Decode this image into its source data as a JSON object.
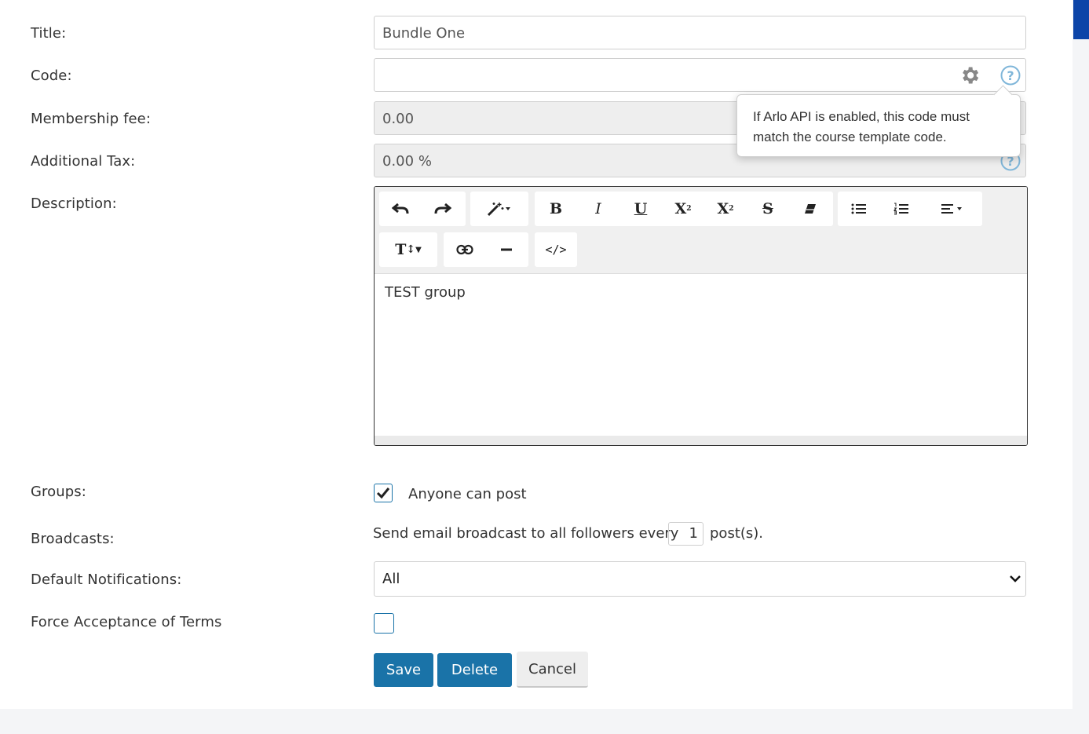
{
  "form": {
    "title": {
      "label": "Title:",
      "value": "Bundle One"
    },
    "code": {
      "label": "Code:",
      "value": ""
    },
    "membership_fee": {
      "label": "Membership fee:",
      "value": "0.00"
    },
    "additional_tax": {
      "label": "Additional Tax:",
      "value": "0.00",
      "unit": "%"
    },
    "description": {
      "label": "Description:",
      "content": "TEST group"
    },
    "groups": {
      "label": "Groups:",
      "checkbox_label": "Anyone can post",
      "checked": true
    },
    "broadcasts": {
      "label": "Broadcasts:",
      "prefix": "Send email broadcast to all followers every",
      "count": "1",
      "suffix": "post(s)."
    },
    "default_notifications": {
      "label": "Default Notifications:",
      "selected": "All"
    },
    "force_terms": {
      "label": "Force Acceptance of Terms",
      "checked": false
    }
  },
  "tooltip": {
    "text": "If Arlo API is enabled, this code must match the course template code."
  },
  "buttons": {
    "save": "Save",
    "delete": "Delete",
    "cancel": "Cancel"
  },
  "colors": {
    "primary": "#1a73a8",
    "scrollbar": "#0c44a8",
    "help_icon": "#7fb6d9"
  }
}
